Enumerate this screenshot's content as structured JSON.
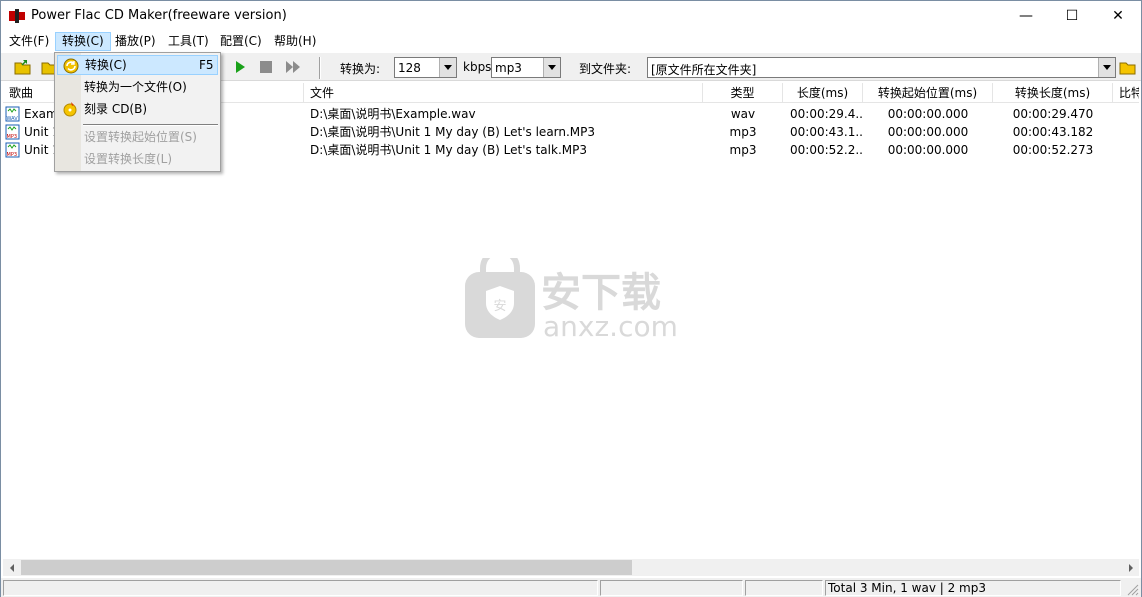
{
  "window": {
    "title": "Power Flac CD Maker(freeware version)",
    "controls": {
      "minimize": "—",
      "maximize": "☐",
      "close": "✕"
    }
  },
  "menu": [
    "文件(F)",
    "转换(C)",
    "播放(P)",
    "工具(T)",
    "配置(C)",
    "帮助(H)"
  ],
  "toolbar": {
    "convert_to_label": "转换为:",
    "bitrate": "128",
    "kbps_label": "kbps",
    "format": "mp3",
    "to_folder_label": "到文件夹:",
    "folder": "[原文件所在文件夹]"
  },
  "list": {
    "headers": [
      "歌曲",
      "文件",
      "类型",
      "长度(ms)",
      "转换起始位置(ms)",
      "转换长度(ms)",
      "比特"
    ],
    "rows": [
      {
        "song": "Exam",
        "file": "D:\\桌面\\说明书\\Example.wav",
        "type": "wav",
        "length": "00:00:29.4...",
        "start": "00:00:00.000",
        "convlen": "00:00:29.470",
        "icon": "wav-file-icon"
      },
      {
        "song": "Unit 1",
        "file": "D:\\桌面\\说明书\\Unit 1 My day   (B)   Let's learn.MP3",
        "type": "mp3",
        "length": "00:00:43.1...",
        "start": "00:00:00.000",
        "convlen": "00:00:43.182",
        "icon": "mp3-file-icon"
      },
      {
        "song": "Unit 1",
        "file": "D:\\桌面\\说明书\\Unit 1 My day   (B)   Let's talk.MP3",
        "type": "mp3",
        "length": "00:00:52.2...",
        "start": "00:00:00.000",
        "convlen": "00:00:52.273",
        "icon": "mp3-file-icon"
      }
    ]
  },
  "dropdown": {
    "items": [
      {
        "label": "转换(C)",
        "shortcut": "F5",
        "enabled": true,
        "icon": "convert-icon"
      },
      {
        "label": "转换为一个文件(O)",
        "shortcut": "",
        "enabled": true,
        "icon": ""
      },
      {
        "label": "刻录 CD(B)",
        "shortcut": "",
        "enabled": true,
        "icon": "burn-cd-icon"
      },
      {
        "label": "设置转换起始位置(S)",
        "shortcut": "",
        "enabled": false,
        "icon": ""
      },
      {
        "label": "设置转换长度(L)",
        "shortcut": "",
        "enabled": false,
        "icon": ""
      }
    ]
  },
  "watermark": {
    "cn": "安下载",
    "en": "anxz.com"
  },
  "status": {
    "summary": "Total 3 Min, 1 wav | 2 mp3"
  },
  "colors": {
    "menu_highlight": "#cce8ff",
    "menu_border": "#99d1ff",
    "play_green": "#1aa11a"
  }
}
